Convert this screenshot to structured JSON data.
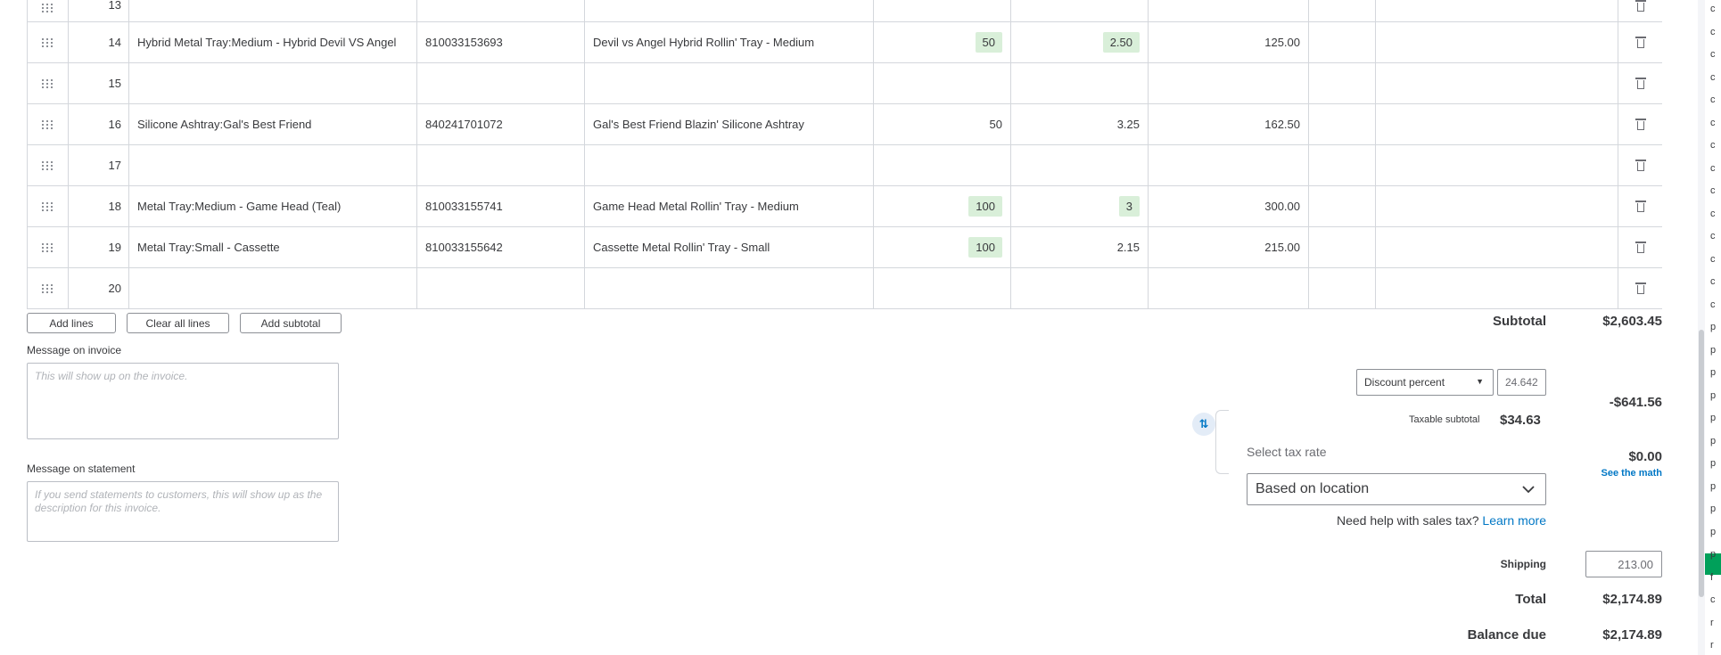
{
  "lines": [
    {
      "num": "13",
      "product": "",
      "sku": "",
      "description": "",
      "qty": "",
      "rate": "",
      "amount": "",
      "qty_hl": false,
      "rate_hl": false
    },
    {
      "num": "14",
      "product": "Hybrid Metal Tray:Medium - Hybrid Devil VS Angel",
      "sku": "810033153693",
      "description": "Devil vs Angel Hybrid Rollin' Tray - Medium",
      "qty": "50",
      "rate": "2.50",
      "amount": "125.00",
      "qty_hl": true,
      "rate_hl": true
    },
    {
      "num": "15",
      "product": "",
      "sku": "",
      "description": "",
      "qty": "",
      "rate": "",
      "amount": "",
      "qty_hl": false,
      "rate_hl": false
    },
    {
      "num": "16",
      "product": "Silicone Ashtray:Gal's Best Friend",
      "sku": "840241701072",
      "description": "Gal's Best Friend Blazin' Silicone Ashtray",
      "qty": "50",
      "rate": "3.25",
      "amount": "162.50",
      "qty_hl": false,
      "rate_hl": false
    },
    {
      "num": "17",
      "product": "",
      "sku": "",
      "description": "",
      "qty": "",
      "rate": "",
      "amount": "",
      "qty_hl": false,
      "rate_hl": false
    },
    {
      "num": "18",
      "product": "Metal Tray:Medium - Game Head (Teal)",
      "sku": "810033155741",
      "description": "Game Head Metal Rollin' Tray - Medium",
      "qty": "100",
      "rate": "3",
      "amount": "300.00",
      "qty_hl": true,
      "rate_hl": true
    },
    {
      "num": "19",
      "product": "Metal Tray:Small - Cassette",
      "sku": "810033155642",
      "description": "Cassette Metal Rollin' Tray - Small",
      "qty": "100",
      "rate": "2.15",
      "amount": "215.00",
      "qty_hl": true,
      "rate_hl": false
    },
    {
      "num": "20",
      "product": "",
      "sku": "",
      "description": "",
      "qty": "",
      "rate": "",
      "amount": "",
      "qty_hl": false,
      "rate_hl": false
    }
  ],
  "buttons": {
    "add_lines": "Add lines",
    "clear_all_lines": "Clear all lines",
    "add_subtotal": "Add subtotal"
  },
  "messages": {
    "invoice_label": "Message on invoice",
    "invoice_placeholder": "This will show up on the invoice.",
    "statement_label": "Message on statement",
    "statement_placeholder": "If you send statements to customers, this will show up as the description for this invoice."
  },
  "totals": {
    "subtotal_label": "Subtotal",
    "subtotal_value": "$2,603.45",
    "discount_type": "Discount percent",
    "discount_value": "24.642",
    "discount_amount": "-$641.56",
    "taxable_subtotal_label": "Taxable subtotal",
    "taxable_subtotal_value": "$34.63",
    "select_tax_rate_label": "Select tax rate",
    "tax_rate_value": "Based on location",
    "tax_amount": "$0.00",
    "see_the_math": "See the math",
    "help_text": "Need help with sales tax?",
    "learn_more": "Learn more",
    "shipping_label": "Shipping",
    "shipping_value": "213.00",
    "total_label": "Total",
    "total_value": "$2,174.89",
    "balance_due_label": "Balance due",
    "balance_due_value": "$2,174.89"
  },
  "colors": {
    "highlight": "#d9efd9",
    "link": "#0077c5",
    "side_accent": "#00a05a"
  },
  "side_strip_letters": [
    "c",
    "c",
    "c",
    "c",
    "c",
    "c",
    "c",
    "c",
    "c",
    "c",
    "c",
    "c",
    "c",
    "c",
    "p",
    "p",
    "p",
    "p",
    "p",
    "p",
    "p",
    "p",
    "p",
    "p",
    "p",
    "f",
    "c",
    "r",
    "r"
  ]
}
